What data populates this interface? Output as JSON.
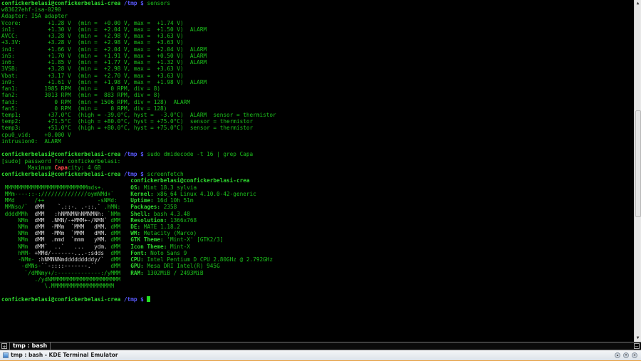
{
  "window": {
    "title": "tmp : bash - KDE Terminal Emulator"
  },
  "tabbar": {
    "new_tab": "+",
    "tab_label": "tmp : bash",
    "close_tab": "−"
  },
  "window_buttons": {
    "minimize": "▾",
    "maximize": "▴",
    "close": "x"
  },
  "colors": {
    "green": "#1cc21c",
    "blue": "#5a5aff",
    "red": "#ff4848",
    "background": "#000000"
  },
  "terminal": {
    "lines": [
      {
        "segs": [
          [
            "confickerbelasi@confickerbelasi-crea",
            "gb"
          ],
          [
            " /tmp $",
            "b"
          ],
          [
            " sensors",
            "g"
          ]
        ]
      },
      {
        "segs": [
          [
            "w83627ehf-isa-0290",
            "g"
          ]
        ]
      },
      {
        "segs": [
          [
            "Adapter: ISA adapter",
            "g"
          ]
        ]
      },
      {
        "segs": [
          [
            "Vcore:        +1.28 V  (min =  +0.00 V, max =  +1.74 V)",
            "g"
          ]
        ]
      },
      {
        "segs": [
          [
            "in1:          +1.30 V  (min =  +2.04 V, max =  +1.50 V)  ALARM",
            "g"
          ]
        ]
      },
      {
        "segs": [
          [
            "AVCC:         +3.28 V  (min =  +2.98 V, max =  +3.63 V)",
            "g"
          ]
        ]
      },
      {
        "segs": [
          [
            "+3.3V:        +3.28 V  (min =  +2.98 V, max =  +3.63 V)",
            "g"
          ]
        ]
      },
      {
        "segs": [
          [
            "in4:          +1.66 V  (min =  +2.04 V, max =  +2.04 V)  ALARM",
            "g"
          ]
        ]
      },
      {
        "segs": [
          [
            "in5:          +1.70 V  (min =  +1.91 V, max =  +0.50 V)  ALARM",
            "g"
          ]
        ]
      },
      {
        "segs": [
          [
            "in6:          +1.85 V  (min =  +1.77 V, max =  +1.32 V)  ALARM",
            "g"
          ]
        ]
      },
      {
        "segs": [
          [
            "3VSB:         +3.28 V  (min =  +2.98 V, max =  +3.63 V)",
            "g"
          ]
        ]
      },
      {
        "segs": [
          [
            "Vbat:         +3.17 V  (min =  +2.70 V, max =  +3.63 V)",
            "g"
          ]
        ]
      },
      {
        "segs": [
          [
            "in9:          +1.61 V  (min =  +1.98 V, max =  +1.98 V)  ALARM",
            "g"
          ]
        ]
      },
      {
        "segs": [
          [
            "fan1:        1985 RPM  (min =    0 RPM, div = 8)",
            "g"
          ]
        ]
      },
      {
        "segs": [
          [
            "fan2:        3013 RPM  (min =  883 RPM, div = 8)",
            "g"
          ]
        ]
      },
      {
        "segs": [
          [
            "fan3:           0 RPM  (min = 1506 RPM, div = 128)  ALARM",
            "g"
          ]
        ]
      },
      {
        "segs": [
          [
            "fan5:           0 RPM  (min =    0 RPM, div = 128)",
            "g"
          ]
        ]
      },
      {
        "segs": [
          [
            "temp1:        +37.0°C  (high = -39.0°C, hyst =  -3.0°C)  ALARM  sensor = thermistor",
            "g"
          ]
        ]
      },
      {
        "segs": [
          [
            "temp2:        +71.5°C  (high = +80.0°C, hyst = +75.0°C)  sensor = thermistor",
            "g"
          ]
        ]
      },
      {
        "segs": [
          [
            "temp3:        +51.0°C  (high = +80.0°C, hyst = +75.0°C)  sensor = thermistor",
            "g"
          ]
        ]
      },
      {
        "segs": [
          [
            "cpu0_vid:    +0.000 V",
            "g"
          ]
        ]
      },
      {
        "segs": [
          [
            "intrusion0:  ALARM",
            "g"
          ]
        ]
      },
      {
        "segs": []
      },
      {
        "segs": [
          [
            "confickerbelasi@confickerbelasi-crea",
            "gb"
          ],
          [
            " /tmp $",
            "b"
          ],
          [
            " sudo dmidecode -t 16 | grep Capa",
            "g"
          ]
        ]
      },
      {
        "segs": [
          [
            "[sudo] password for confickerbelasi:",
            "g"
          ]
        ]
      },
      {
        "segs": [
          [
            "        Maximum ",
            "g"
          ],
          [
            "Capa",
            "r"
          ],
          [
            "city: 4 GB",
            "g"
          ]
        ]
      },
      {
        "segs": [
          [
            "confickerbelasi@confickerbelasi-crea",
            "gb"
          ],
          [
            " /tmp $",
            "b"
          ],
          [
            " screenfetch",
            "g"
          ]
        ]
      },
      {
        "art": [],
        "info": [
          [
            "confickerbelasi@confickerbelasi-crea",
            "gb"
          ]
        ]
      },
      {
        "art": [
          [
            " MMMMMMMMMMMMMMMMMMMMMMMMMmds+.",
            "g"
          ]
        ],
        "info": [
          [
            "OS:",
            "gb"
          ],
          [
            " Mint 18.3 sylvia",
            "g"
          ]
        ]
      },
      {
        "art": [
          [
            " MMm----::-://////////////oymNMd+`",
            "g"
          ]
        ],
        "info": [
          [
            "Kernel:",
            "gb"
          ],
          [
            " x86_64 Linux 4.10.0-42-generic",
            "g"
          ]
        ]
      },
      {
        "art": [
          [
            " MMd      /++                -sNMd:",
            "g"
          ]
        ],
        "info": [
          [
            "Uptime:",
            "gb"
          ],
          [
            " 16d 10h 51m",
            "g"
          ]
        ]
      },
      {
        "art": [
          [
            " MMNso/`  ",
            "g"
          ],
          [
            "dMM    `.::-. .-::.`",
            "w"
          ],
          [
            " .hMN:",
            "g"
          ]
        ],
        "info": [
          [
            "Packages:",
            "gb"
          ],
          [
            " 2358",
            "g"
          ]
        ]
      },
      {
        "art": [
          [
            " ddddMMh  ",
            "g"
          ],
          [
            "dMM   :hNMNMNhNMNMNh:",
            "w"
          ],
          [
            " `NMm",
            "g"
          ]
        ],
        "info": [
          [
            "Shell:",
            "gb"
          ],
          [
            " bash 4.3.48",
            "g"
          ]
        ]
      },
      {
        "art": [
          [
            "     NMm  ",
            "g"
          ],
          [
            "dMM  .NMN/-+MMM+-/NMN`",
            "w"
          ],
          [
            " dMM",
            "g"
          ]
        ],
        "info": [
          [
            "Resolution:",
            "gb"
          ],
          [
            " 1366x768",
            "g"
          ]
        ]
      },
      {
        "art": [
          [
            "     NMm  ",
            "g"
          ],
          [
            "dMM  -MMm  `MMM   dMM.",
            "w"
          ],
          [
            " dMM",
            "g"
          ]
        ],
        "info": [
          [
            "DE:",
            "gb"
          ],
          [
            " MATE 1.18.2",
            "g"
          ]
        ]
      },
      {
        "art": [
          [
            "     NMm  ",
            "g"
          ],
          [
            "dMM  -MMm  `MMM   dMM.",
            "w"
          ],
          [
            " dMM",
            "g"
          ]
        ],
        "info": [
          [
            "WM:",
            "gb"
          ],
          [
            " Metacity (Marco)",
            "g"
          ]
        ]
      },
      {
        "art": [
          [
            "     NMm  ",
            "g"
          ],
          [
            "dMM  .mmd  `mmm   yMM.",
            "w"
          ],
          [
            " dMM",
            "g"
          ]
        ],
        "info": [
          [
            "GTK Theme:",
            "gb"
          ],
          [
            " 'Mint-X' [GTK2/3]",
            "g"
          ]
        ]
      },
      {
        "art": [
          [
            "     NMm  ",
            "g"
          ],
          [
            "dMM`  ..`   ...   ydm.",
            "w"
          ],
          [
            " dMM",
            "g"
          ]
        ],
        "info": [
          [
            "Icon Theme:",
            "gb"
          ],
          [
            " Mint-X",
            "g"
          ]
        ]
      },
      {
        "art": [
          [
            "     hMM- ",
            "g"
          ],
          [
            "+MMd/-------...-:sdds",
            "w"
          ],
          [
            "  dMM",
            "g"
          ]
        ],
        "info": [
          [
            "Font:",
            "gb"
          ],
          [
            " Noto Sans 9",
            "g"
          ]
        ]
      },
      {
        "art": [
          [
            "     -NMm- ",
            "g"
          ],
          [
            ":hNMNNNmdddddddddy/`",
            "w"
          ],
          [
            "  dMM",
            "g"
          ]
        ],
        "info": [
          [
            "CPU:",
            "gb"
          ],
          [
            " Intel Pentium D CPU 2.80GHz @ 2.792GHz",
            "g"
          ]
        ]
      },
      {
        "art": [
          [
            "      -dMNs-",
            "g"
          ],
          [
            "``-::::-------.``",
            "w"
          ],
          [
            "    dMM",
            "g"
          ]
        ],
        "info": [
          [
            "GPU:",
            "gb"
          ],
          [
            " Mesa DRI Intel(R) 945G",
            "g"
          ]
        ]
      },
      {
        "art": [
          [
            "       `/dMNmy+/:-------------:/yMMM",
            "g"
          ]
        ],
        "info": [
          [
            "RAM:",
            "gb"
          ],
          [
            " 1302MiB / 2493MiB",
            "g"
          ]
        ]
      },
      {
        "art": [
          [
            "          ./ydNMMMMMMMMMMMMMMMMMMMMM",
            "g"
          ]
        ],
        "info": []
      },
      {
        "art": [
          [
            "             \\.MMMMMMMMMMMMMMMMMMM",
            "g"
          ]
        ],
        "info": []
      },
      {
        "segs": []
      },
      {
        "segs": [
          [
            "confickerbelasi@confickerbelasi-crea",
            "gb"
          ],
          [
            " /tmp $",
            "b"
          ],
          [
            " ",
            "g"
          ]
        ],
        "cursor": true
      }
    ]
  }
}
